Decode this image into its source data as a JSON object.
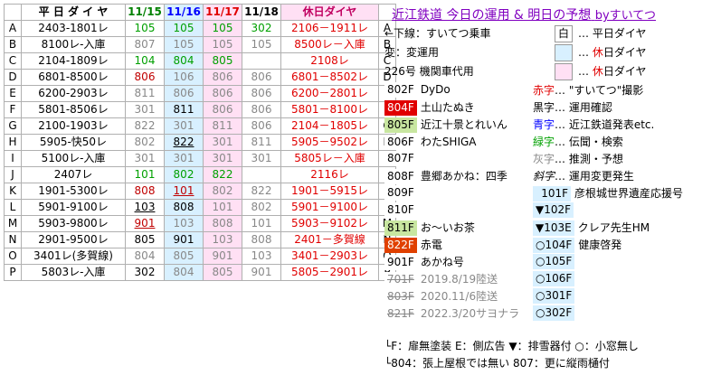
{
  "header": {
    "weekday": "平 日 ダ イ ヤ",
    "d1": "11/15",
    "d2": "11/16",
    "d3": "11/17",
    "d4": "11/18",
    "holiday": "休日ダイヤ"
  },
  "rows": [
    {
      "l": "A",
      "wd": "2403-1801レ",
      "v": [
        "105",
        "105",
        "105",
        "302"
      ],
      "hol": "2106－1911レ"
    },
    {
      "l": "B",
      "wd": "8100レ-入庫",
      "v": [
        "807",
        "105",
        "105",
        "105"
      ],
      "hol": "8500レ－入庫"
    },
    {
      "l": "C",
      "wd": "2104-1809レ",
      "v": [
        "104",
        "804",
        "805",
        ""
      ],
      "hol": "2108レ"
    },
    {
      "l": "D",
      "wd": "6801-8500レ",
      "v": [
        "806",
        "106",
        "806",
        "806"
      ],
      "hol": "6801－8502レ"
    },
    {
      "l": "E",
      "wd": "6200-2903レ",
      "v": [
        "811",
        "806",
        "806",
        "806"
      ],
      "hol": "6200－2801レ"
    },
    {
      "l": "F",
      "wd": "5801-8506レ",
      "v": [
        "301",
        "811",
        "806",
        "806"
      ],
      "hol": "5801－8100レ"
    },
    {
      "l": "G",
      "wd": "2100-1903レ",
      "v": [
        "822",
        "301",
        "811",
        "806"
      ],
      "hol": "2104－1805レ"
    },
    {
      "l": "H",
      "wd": "5905-快50レ",
      "v": [
        "802",
        "822",
        "301",
        "811"
      ],
      "hol": "5905－9502レ"
    },
    {
      "l": "I",
      "wd": "5100レ-入庫",
      "v": [
        "301",
        "301",
        "301",
        "301"
      ],
      "hol": "5805レ－入庫"
    },
    {
      "l": "J",
      "wd": "2407レ",
      "v": [
        "101",
        "802",
        "822",
        ""
      ],
      "hol": "2116レ"
    },
    {
      "l": "K",
      "wd": "1901-5300レ",
      "v": [
        "808",
        "101",
        "802",
        "822"
      ],
      "hol": "1901－5915レ"
    },
    {
      "l": "L",
      "wd": "5901-9100レ",
      "v": [
        "103",
        "808",
        "101",
        "802"
      ],
      "hol": "5901－9100レ"
    },
    {
      "l": "M",
      "wd": "5903-9800レ",
      "v": [
        "901",
        "103",
        "808",
        "101"
      ],
      "hol": "5903－9102レ"
    },
    {
      "l": "N",
      "wd": "2901-9500レ",
      "v": [
        "805",
        "901",
        "103",
        "808"
      ],
      "hol": "2401－多賀線"
    },
    {
      "l": "O",
      "wd": "3401レ(多賀線)",
      "v": [
        "804",
        "805",
        "901",
        "103"
      ],
      "hol": "3401－2903レ"
    },
    {
      "l": "P",
      "wd": "5803レ-入庫",
      "v": [
        "302",
        "804",
        "805",
        "901"
      ],
      "hol": "5805－2901レ"
    }
  ],
  "right": {
    "title": "近江鉄道 今日の運用 & 明日の予想",
    "by": "byすいてつ",
    "legend1": "←下線：すいてつ乗車",
    "legend2": "変：変運用",
    "legend3": "226号 機関車代用",
    "key_white": "白",
    "key1": "… 平日ダイヤ",
    "key2": "… 休日ダイヤ",
    "key3": "… 休日ダイヤ",
    "items": [
      {
        "code": "802F",
        "name": "DyDo"
      },
      {
        "code": "804F",
        "name": "土山たぬき"
      },
      {
        "code": "805F",
        "name": "近江十景とれいん"
      },
      {
        "code": "806F",
        "name": "わたSHIGA"
      },
      {
        "code": "807F",
        "name": ""
      },
      {
        "code": "808F",
        "name": "豊郷あかね：四季"
      },
      {
        "code": "809F",
        "name": ""
      },
      {
        "code": "810F",
        "name": ""
      },
      {
        "code": "811F",
        "name": "お～いお茶"
      },
      {
        "code": "822F",
        "name": "赤電"
      },
      {
        "code": "901F",
        "name": "あかね号"
      },
      {
        "code": "701F",
        "name": "2019.8/19陸送"
      },
      {
        "code": "803F",
        "name": "2020.11/6陸送"
      },
      {
        "code": "821F",
        "name": "2022.3/20サヨナラ"
      }
    ],
    "legend_colors": [
      {
        "c": "赤字",
        "t": "… \"すいてつ\"撮影"
      },
      {
        "c": "黒字",
        "t": "… 運用確認"
      },
      {
        "c": "青字",
        "t": "… 近江鉄道発表etc."
      },
      {
        "c": "緑字",
        "t": "… 伝聞・検索"
      },
      {
        "c": "灰字",
        "t": "… 推測・予想"
      },
      {
        "c": "斜字",
        "t": "… 運用変更発生"
      }
    ],
    "trains": [
      {
        "code": "101F",
        "name": "彦根城世界遺産応援号"
      },
      {
        "code": "▼102F",
        "name": ""
      },
      {
        "code": "▼103E",
        "name": "クレア先生HM"
      },
      {
        "code": "○104F",
        "name": "健康啓発"
      },
      {
        "code": "○105F",
        "name": ""
      },
      {
        "code": "○106F",
        "name": ""
      },
      {
        "code": "○301F",
        "name": ""
      },
      {
        "code": "○302F",
        "name": ""
      }
    ],
    "foot1": "└F：扉無塗装  E：側広告 ▼：排雪器付 ○：小窓無し",
    "foot2": "└804：張上屋根では無い 807：更に縦雨樋付"
  }
}
